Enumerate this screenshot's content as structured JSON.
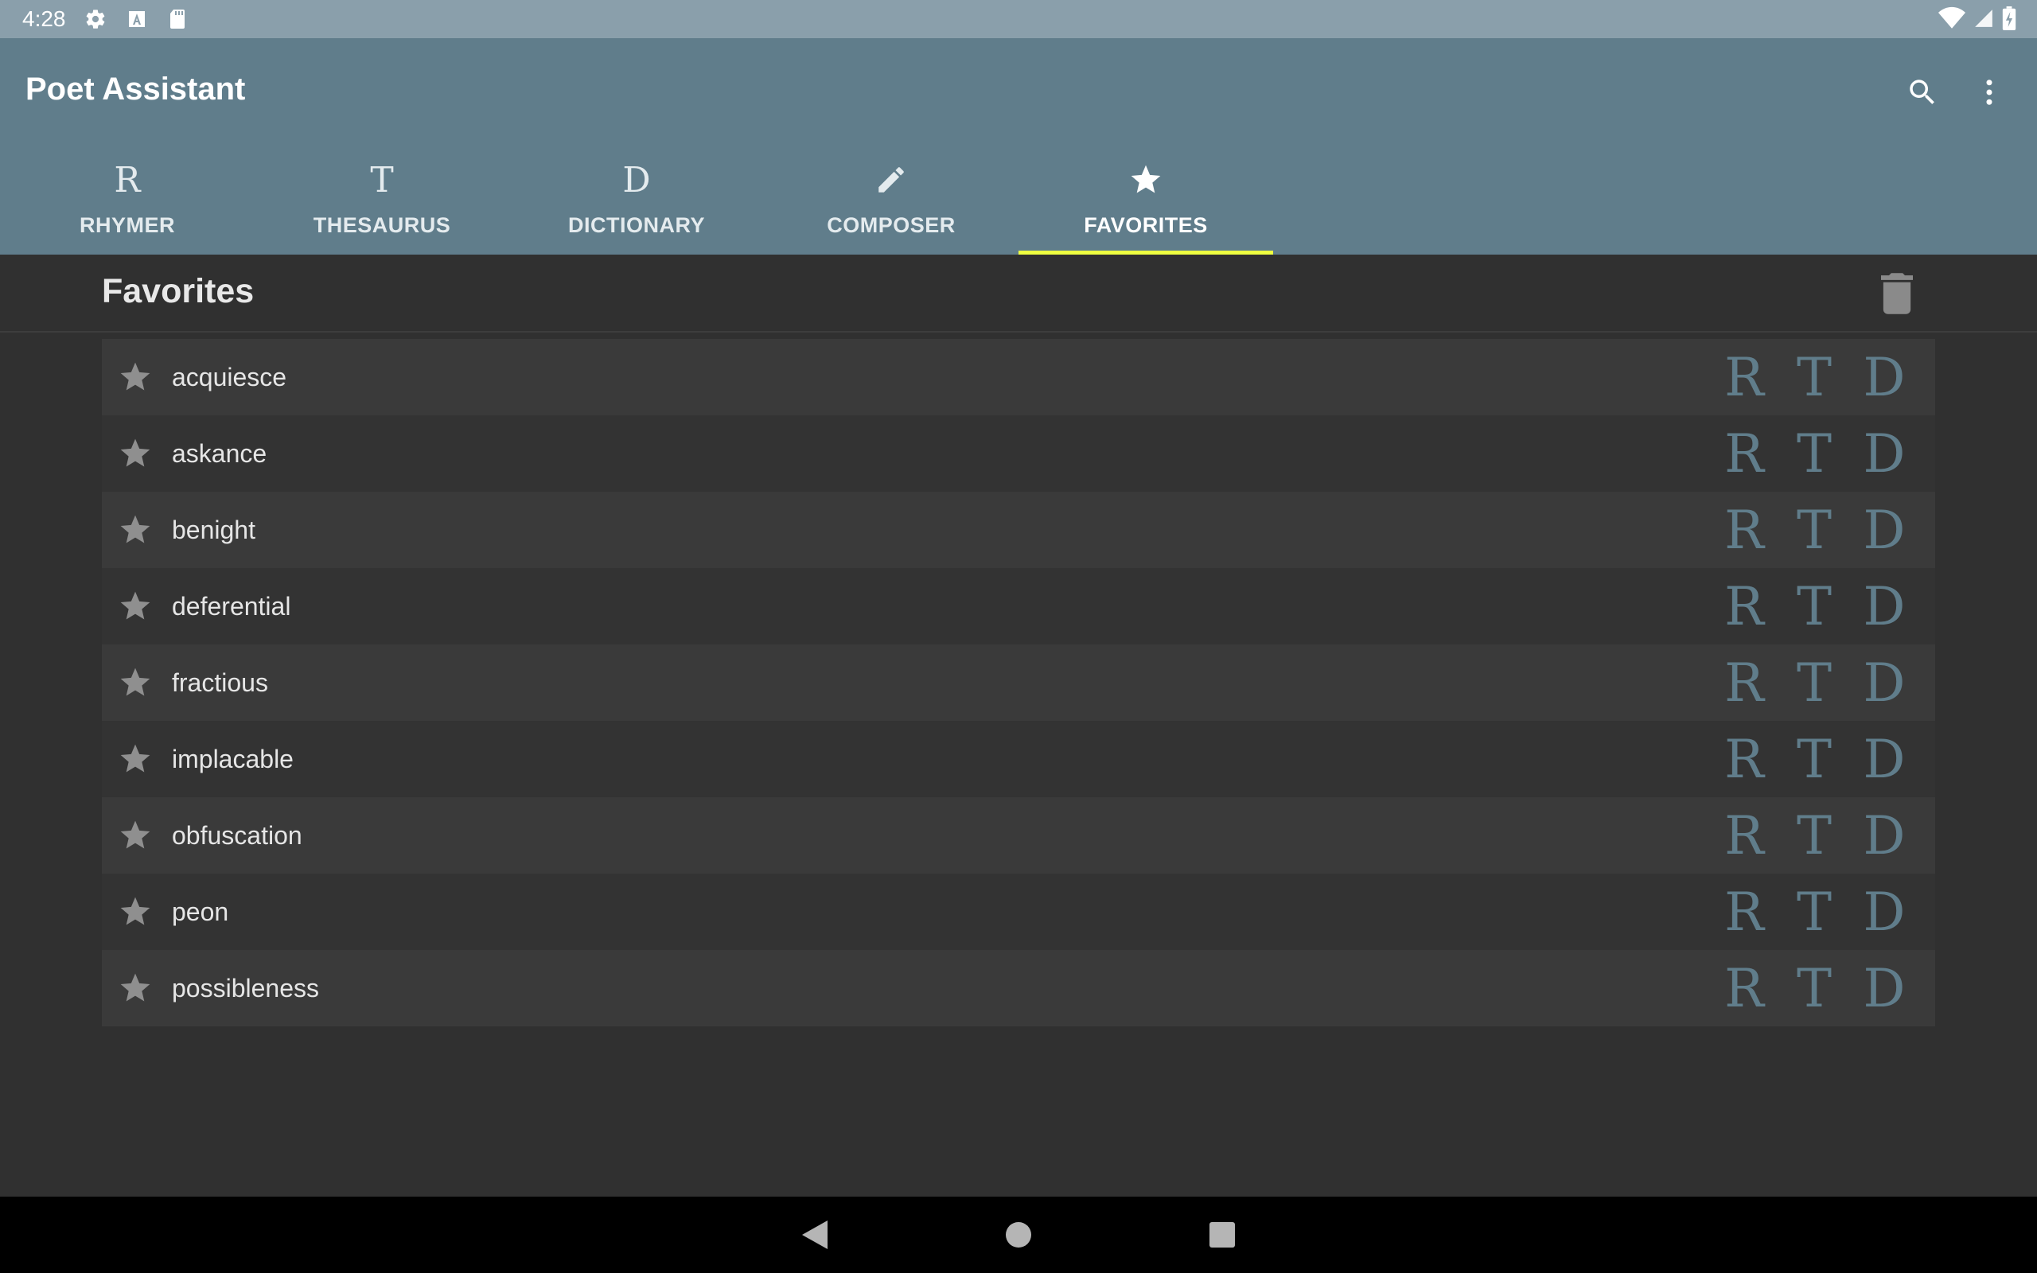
{
  "status_bar": {
    "time": "4:28",
    "icons": [
      "gear-icon",
      "text-a-icon",
      "sd-card-icon"
    ],
    "right_icons": [
      "wifi-icon",
      "signal-icon",
      "battery-icon"
    ]
  },
  "app_bar": {
    "title": "Poet Assistant",
    "actions": [
      "search-icon",
      "more-vert-icon"
    ]
  },
  "tabs": [
    {
      "label": "RHYMER",
      "glyph": "R",
      "active": false
    },
    {
      "label": "THESAURUS",
      "glyph": "T",
      "active": false
    },
    {
      "label": "DICTIONARY",
      "glyph": "D",
      "active": false
    },
    {
      "label": "COMPOSER",
      "glyph": "",
      "icon": "pencil-icon",
      "active": false
    },
    {
      "label": "FAVORITES",
      "glyph": "",
      "icon": "star-icon",
      "active": true
    }
  ],
  "content": {
    "title": "Favorites",
    "clear_action": "trash-icon"
  },
  "favorites": [
    {
      "word": "acquiesce"
    },
    {
      "word": "askance"
    },
    {
      "word": "benight"
    },
    {
      "word": "deferential"
    },
    {
      "word": "fractious"
    },
    {
      "word": "implacable"
    },
    {
      "word": "obfuscation"
    },
    {
      "word": "peon"
    },
    {
      "word": "possibleness"
    }
  ],
  "row_actions": {
    "rhymer": "R",
    "thesaurus": "T",
    "dictionary": "D"
  },
  "colors": {
    "accent": "#eeff41",
    "primary": "#607d8b",
    "status_bar": "#8a9fab",
    "background": "#303030"
  }
}
